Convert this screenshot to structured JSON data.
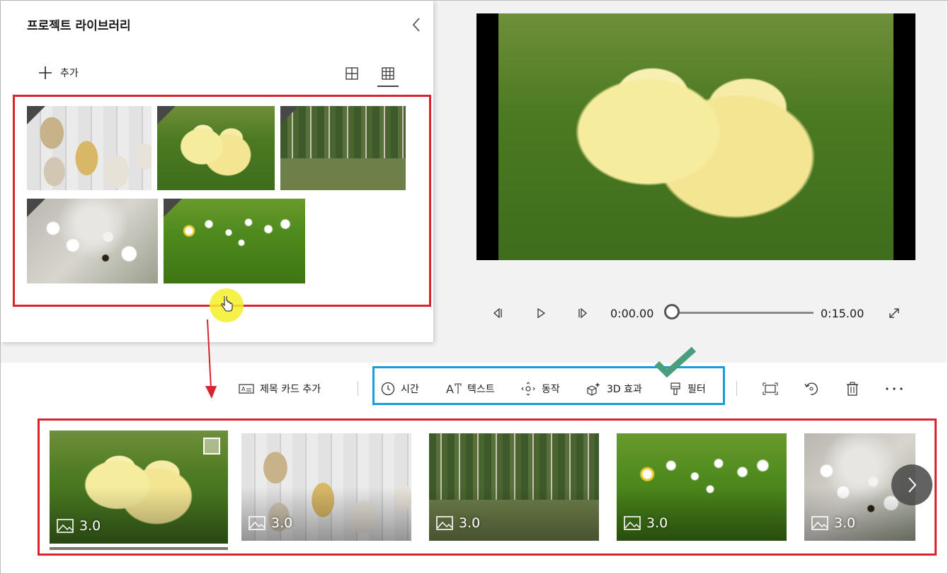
{
  "library": {
    "title": "프로젝트 라이브러리",
    "add_label": "추가",
    "items": [
      {
        "name": "easter-eggs"
      },
      {
        "name": "chicks"
      },
      {
        "name": "ivy-building"
      },
      {
        "name": "cherry-blossom-bee"
      },
      {
        "name": "daisies"
      }
    ]
  },
  "player": {
    "current_time": "0:00.00",
    "total_time": "0:15.00",
    "progress": 0
  },
  "toolbar": {
    "title_card": "제목 카드 추가",
    "duration": "시간",
    "text": "텍스트",
    "motion": "동작",
    "effects_3d": "3D 효과",
    "filters": "필터"
  },
  "storyboard": {
    "cards": [
      {
        "image": "chicks",
        "duration": "3.0",
        "selected": true
      },
      {
        "image": "easter-eggs",
        "duration": "3.0"
      },
      {
        "image": "ivy-building",
        "duration": "3.0"
      },
      {
        "image": "daisies",
        "duration": "3.0"
      },
      {
        "image": "cherry-blossom-bee",
        "duration": "3.0"
      }
    ]
  },
  "colors": {
    "annotation_red": "#d9242d",
    "annotation_blue": "#1a9cd8",
    "checkmark_green": "#4a9e7c",
    "cursor_highlight": "#f5ee28"
  }
}
